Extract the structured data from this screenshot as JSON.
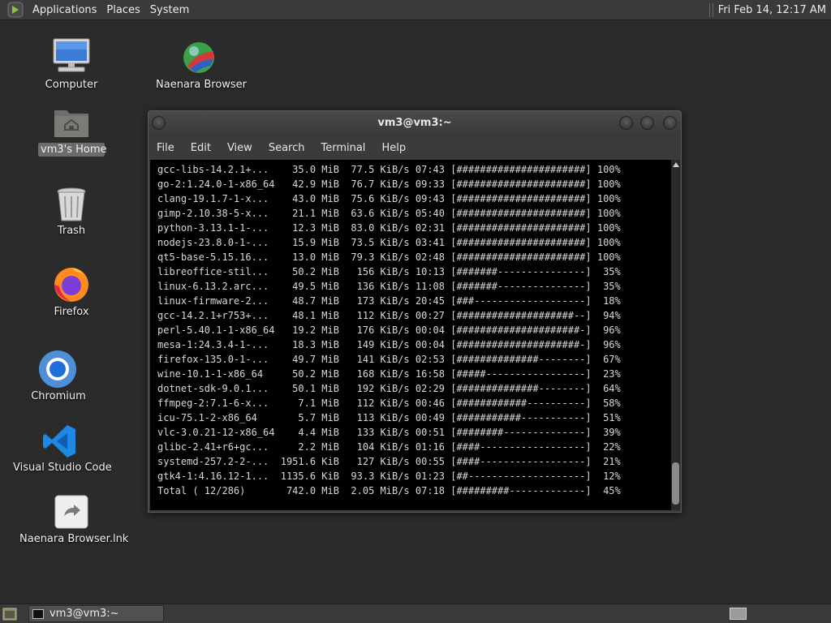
{
  "top_panel": {
    "menus": [
      "Applications",
      "Places",
      "System"
    ],
    "clock": "Fri Feb 14, 12:17 AM"
  },
  "desktop": {
    "icons": {
      "computer": "Computer",
      "naenara": "Naenara Browser",
      "home": "vm3's Home",
      "trash": "Trash",
      "firefox": "Firefox",
      "chromium": "Chromium",
      "vscode": "Visual Studio Code",
      "naenara_lnk": "Naenara Browser.lnk"
    }
  },
  "terminal": {
    "title": "vm3@vm3:~",
    "menu": [
      "File",
      "Edit",
      "View",
      "Search",
      "Terminal",
      "Help"
    ],
    "lines": [
      "gcc-libs-14.2.1+...    35.0 MiB  77.5 KiB/s 07:43 [######################] 100%",
      "go-2:1.24.0-1-x86_64   42.9 MiB  76.7 KiB/s 09:33 [######################] 100%",
      "clang-19.1.7-1-x...    43.0 MiB  75.6 KiB/s 09:43 [######################] 100%",
      "gimp-2.10.38-5-x...    21.1 MiB  63.6 KiB/s 05:40 [######################] 100%",
      "python-3.13.1-1-...    12.3 MiB  83.0 KiB/s 02:31 [######################] 100%",
      "nodejs-23.8.0-1-...    15.9 MiB  73.5 KiB/s 03:41 [######################] 100%",
      "qt5-base-5.15.16...    13.0 MiB  79.3 KiB/s 02:48 [######################] 100%",
      "libreoffice-stil...    50.2 MiB   156 KiB/s 10:13 [#######---------------]  35%",
      "linux-6.13.2.arc...    49.5 MiB   136 KiB/s 11:08 [#######---------------]  35%",
      "linux-firmware-2...    48.7 MiB   173 KiB/s 20:45 [###-------------------]  18%",
      "gcc-14.2.1+r753+...    48.1 MiB   112 KiB/s 00:27 [####################--]  94%",
      "perl-5.40.1-1-x86_64   19.2 MiB   176 KiB/s 00:04 [#####################-]  96%",
      "mesa-1:24.3.4-1-...    18.3 MiB   149 KiB/s 00:04 [#####################-]  96%",
      "firefox-135.0-1-...    49.7 MiB   141 KiB/s 02:53 [##############--------]  67%",
      "wine-10.1-1-x86_64     50.2 MiB   168 KiB/s 16:58 [#####-----------------]  23%",
      "dotnet-sdk-9.0.1...    50.1 MiB   192 KiB/s 02:29 [##############--------]  64%",
      "ffmpeg-2:7.1-6-x...     7.1 MiB   112 KiB/s 00:46 [############----------]  58%",
      "icu-75.1-2-x86_64       5.7 MiB   113 KiB/s 00:49 [###########-----------]  51%",
      "vlc-3.0.21-12-x86_64    4.4 MiB   133 KiB/s 00:51 [########--------------]  39%",
      "glibc-2.41+r6+gc...     2.2 MiB   104 KiB/s 01:16 [####------------------]  22%",
      "systemd-257.2-2-...  1951.6 KiB   127 KiB/s 00:55 [####------------------]  21%",
      "gtk4-1:4.16.12-1...  1135.6 KiB  93.3 KiB/s 01:23 [##--------------------]  12%",
      "Total ( 12/286)       742.0 MiB  2.05 MiB/s 07:18 [#########-------------]  45%"
    ]
  },
  "taskbar": {
    "window_label": "vm3@vm3:~"
  }
}
